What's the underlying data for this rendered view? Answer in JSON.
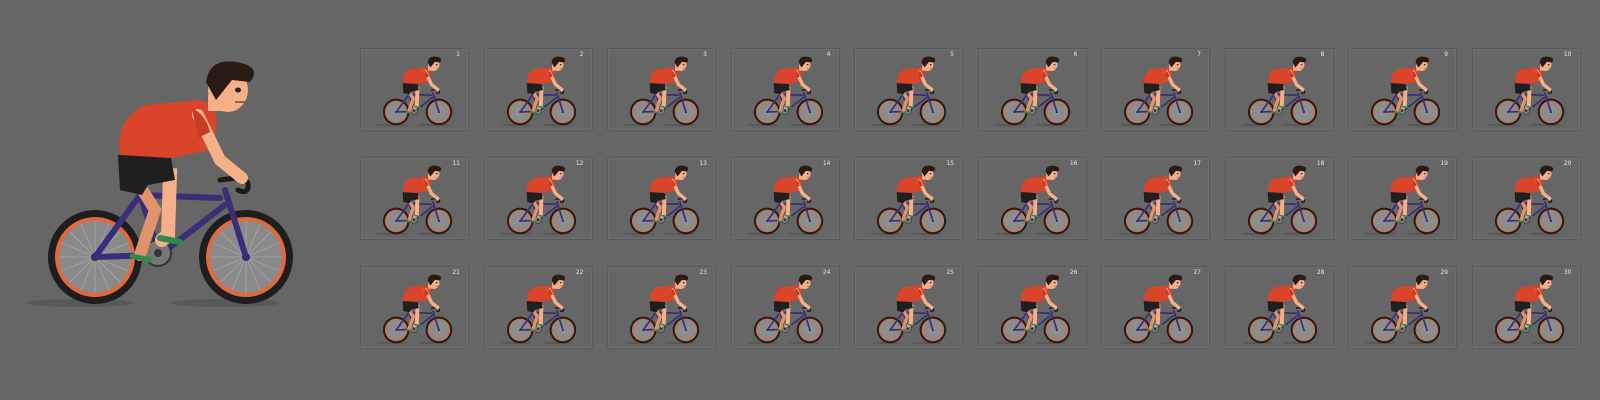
{
  "frames": [
    "1",
    "2",
    "3",
    "4",
    "5",
    "6",
    "7",
    "8",
    "9",
    "10",
    "11",
    "12",
    "13",
    "14",
    "15",
    "16",
    "17",
    "18",
    "19",
    "20",
    "21",
    "22",
    "23",
    "24",
    "25",
    "26",
    "27",
    "28",
    "29",
    "30"
  ],
  "colors": {
    "background": "#666666",
    "jersey": "#d9442a",
    "frame": "#3a2d7a",
    "tire": "#1e1e1e",
    "rim": "#e06a3c",
    "skin": "#f6b088",
    "hair": "#2a1a14"
  }
}
